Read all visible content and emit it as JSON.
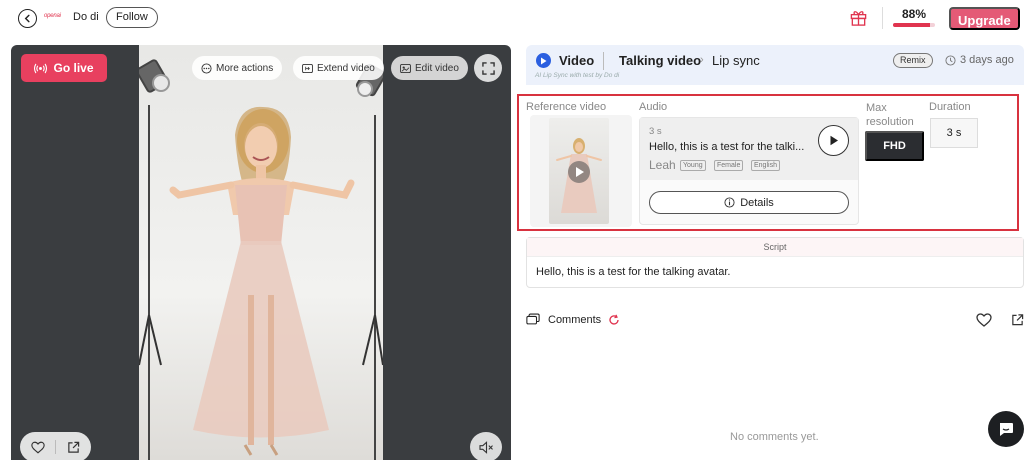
{
  "topbar": {
    "brand_logo": "openai",
    "username": "Do di",
    "follow_label": "Follow",
    "progress_percent": "88%",
    "progress_value": 0.88,
    "upgrade_label": "Upgrade",
    "icons": [
      "back-arrow-icon",
      "gift-icon"
    ]
  },
  "video_panel": {
    "go_live_label": "Go live",
    "more_actions_label": "More actions",
    "extend_video_label": "Extend video",
    "edit_video_label": "Edit video",
    "icons": [
      "broadcast-icon",
      "more-dots-icon",
      "extend-icon",
      "edit-icon",
      "fullscreen-icon",
      "heart-icon",
      "share-icon",
      "mute-icon"
    ]
  },
  "detail_header": {
    "type_label": "Video",
    "breadcrumb": [
      "Talking video",
      "Lip sync"
    ],
    "subline": "AI Lip Sync with test by Do di",
    "remix_label": "Remix",
    "time_ago": "3 days ago"
  },
  "info": {
    "reference_video_label": "Reference video",
    "audio_label": "Audio",
    "max_resolution_label": "Max resolution",
    "duration_label": "Duration",
    "audio": {
      "duration": "3 s",
      "text": "Hello, this is a test for the talki...",
      "voice_name": "Leah",
      "tags": [
        "Young",
        "Female",
        "English"
      ],
      "details_label": "Details"
    },
    "resolution_value": "FHD",
    "duration_value": "3 s"
  },
  "script": {
    "header": "Script",
    "text": "Hello, this is a test for the talking avatar."
  },
  "comments": {
    "label": "Comments",
    "empty_text": "No comments yet."
  },
  "colors": {
    "accent": "#e0344f",
    "go_live": "#e8405f",
    "upgrade": "#e45a76",
    "video_badge": "#2b5fe0",
    "highlight_border": "#d8323f"
  }
}
